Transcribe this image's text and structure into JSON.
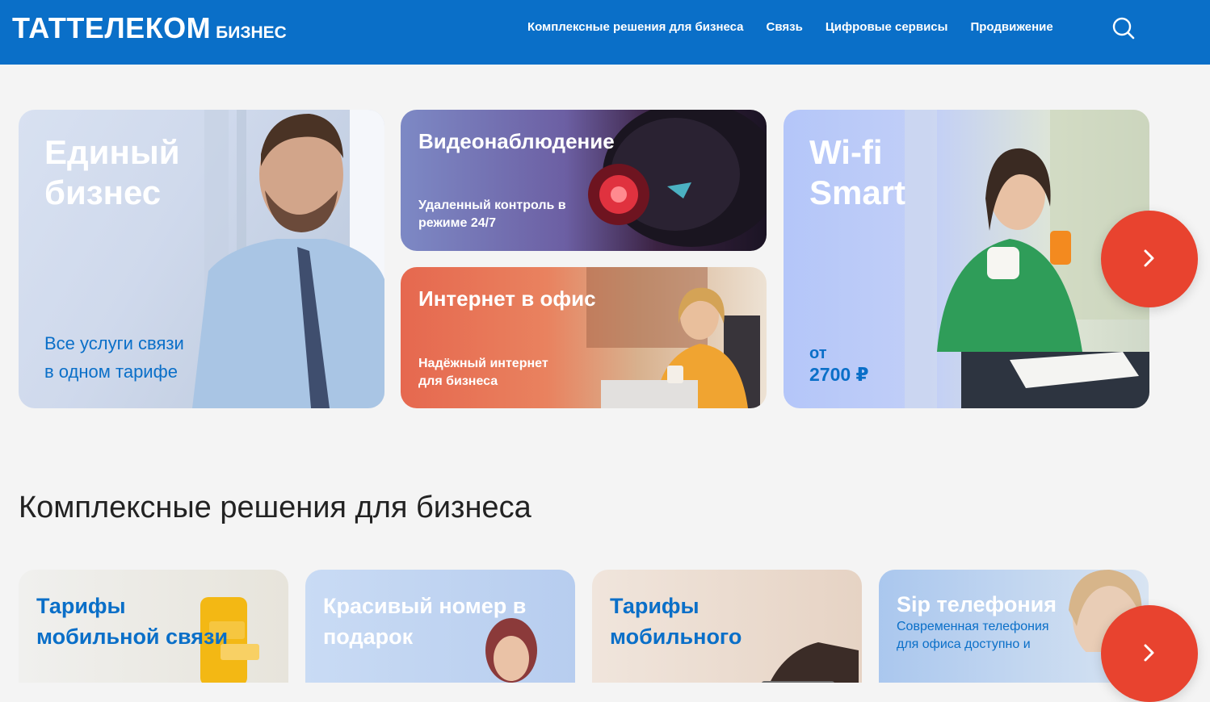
{
  "header": {
    "logo_main": "ТАТТЕЛЕКОМ",
    "logo_sub": "БИЗНЕС",
    "nav": [
      "Комплексные решения для бизнеса",
      "Связь",
      "Цифровые сервисы",
      "Продвижение"
    ],
    "search_icon": "search-icon"
  },
  "banners": {
    "business": {
      "title_line1": "Единый",
      "title_line2": "бизнес",
      "desc_line1": "Все услуги связи",
      "desc_line2": "в одном тарифе"
    },
    "video": {
      "title": "Видеонаблюдение",
      "desc_line1": "Удаленный контроль в",
      "desc_line2": "режиме 24/7"
    },
    "internet": {
      "title": "Интернет в офис",
      "desc_line1": "Надёжный интернет",
      "desc_line2": "для бизнеса"
    },
    "wifi": {
      "title_line1": "Wi-fi",
      "title_line2": "Smart",
      "price_prefix": "от",
      "price": "2700 ₽"
    }
  },
  "next_icon": "chevron-right-icon",
  "section": {
    "title": "Комплексные решения для бизнеса"
  },
  "solutions": [
    {
      "line1": "Тарифы",
      "line2": "мобильной связи"
    },
    {
      "line1": "Красивый номер в",
      "line2": "подарок"
    },
    {
      "line1": "Тарифы",
      "line2": "мобильного"
    },
    {
      "line1": "Sip телефония",
      "sub1": "Современная телефония",
      "sub2": "для офиса доступно и"
    }
  ],
  "colors": {
    "header": "#0a6fc8",
    "accent": "#e8432f",
    "link_blue": "#0a6fc8"
  }
}
